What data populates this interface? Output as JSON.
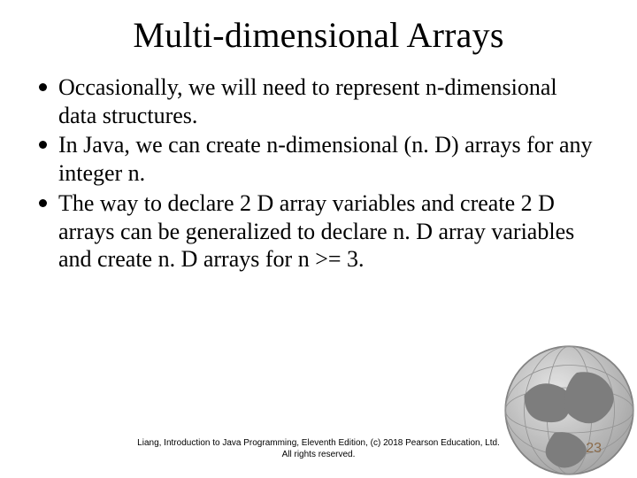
{
  "slide": {
    "title": "Multi-dimensional Arrays",
    "bullets": [
      "Occasionally, we will need to represent n-dimensional data structures.",
      "In Java, we can create n-dimensional (n. D) arrays for any integer n.",
      "The way to declare 2 D array variables and create 2 D arrays can be generalized to declare n. D array variables and create n. D arrays for n >= 3."
    ],
    "footer_line1": "Liang, Introduction to Java Programming, Eleventh Edition, (c) 2018 Pearson Education, Ltd.",
    "footer_line2": "All rights reserved.",
    "page_number": "23"
  }
}
